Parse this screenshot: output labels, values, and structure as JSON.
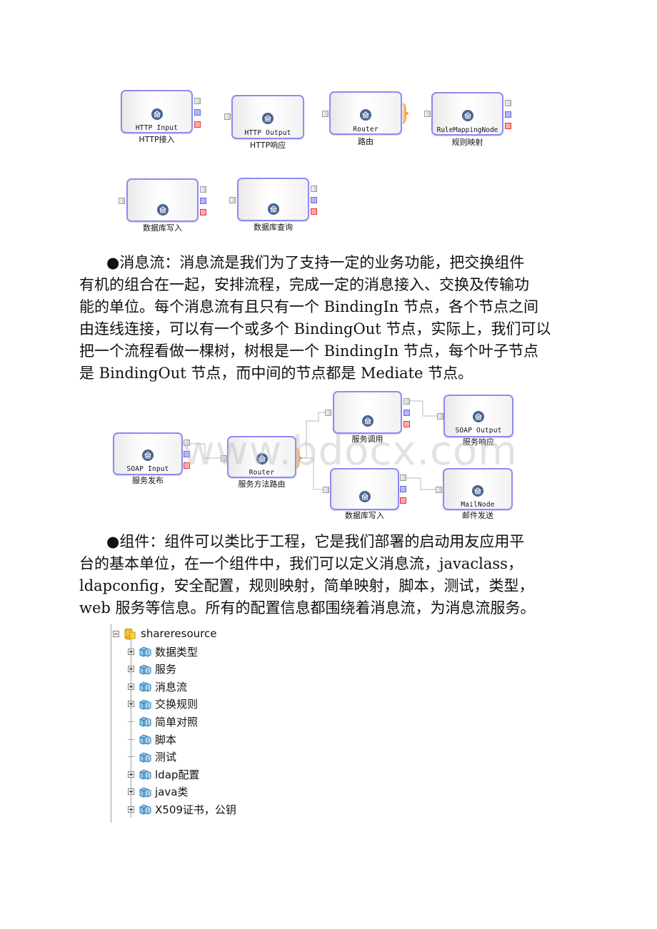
{
  "diagram1": {
    "nodes": [
      {
        "type": "HTTP Input",
        "caption": "HTTP接入"
      },
      {
        "type": "HTTP Output",
        "caption": "HTTP响应"
      },
      {
        "type": "Router",
        "caption": "路由"
      },
      {
        "type": "RuleMappingNode",
        "caption": "规则映射"
      },
      {
        "type": "",
        "caption": "数据库写入"
      },
      {
        "type": "",
        "caption": "数据库查询"
      }
    ]
  },
  "paragraph1": {
    "lines": [
      "●消息流：消息流是我们为了支持一定的业务功能，把交换组件",
      "有机的组合在一起，安排流程，完成一定的消息接入、交换及传输功",
      "能的单位。每个消息流有且只有一个 BindingIn 节点，各个节点之间",
      "由连线连接，可以有一个或多个 BindingOut 节点，实际上，我们可以",
      "把一个流程看做一棵树，树根是一个 BindingIn 节点，每个叶子节点",
      "是 BindingOut 节点，而中间的节点都是 Mediate 节点。"
    ]
  },
  "diagram2": {
    "nodes": [
      {
        "type": "SOAP Input",
        "caption": "服务发布"
      },
      {
        "type": "Router",
        "caption": "服务方法路由"
      },
      {
        "type": "",
        "caption": "服务调用"
      },
      {
        "type": "SOAP Output",
        "caption": "服务响应"
      },
      {
        "type": "",
        "caption": "数据库写入"
      },
      {
        "type": "MailNode",
        "caption": "邮件发送"
      }
    ],
    "watermark": "www.bdocx.com"
  },
  "paragraph2": {
    "lines": [
      "●组件：组件可以类比于工程，它是我们部署的启动用友应用平",
      "台的基本单位，在一个组件中，我们可以定义消息流，javaclass，",
      "ldapconfig，安全配置，规则映射，简单映射，脚本，测试，类型，",
      "web 服务等信息。所有的配置信息都围绕着消息流，为消息流服务。"
    ]
  },
  "tree": {
    "root": {
      "label": "shareresource",
      "icon": "database-icon",
      "expanded": true
    },
    "items": [
      {
        "label": "数据类型",
        "expandable": true
      },
      {
        "label": "服务",
        "expandable": true
      },
      {
        "label": "消息流",
        "expandable": true
      },
      {
        "label": "交换规则",
        "expandable": true
      },
      {
        "label": "简单对照",
        "expandable": false
      },
      {
        "label": "脚本",
        "expandable": false
      },
      {
        "label": "测试",
        "expandable": false
      },
      {
        "label": "ldap配置",
        "expandable": true
      },
      {
        "label": "java类",
        "expandable": true
      },
      {
        "label": "X509证书，公钥",
        "expandable": true
      }
    ]
  },
  "colors": {
    "node_border": "#8c8cf2",
    "node_icon": "#4d6592",
    "port_fail": "#b4b4ff",
    "port_catch": "#ffaaaa",
    "router_brace": "#ff8a1e"
  }
}
